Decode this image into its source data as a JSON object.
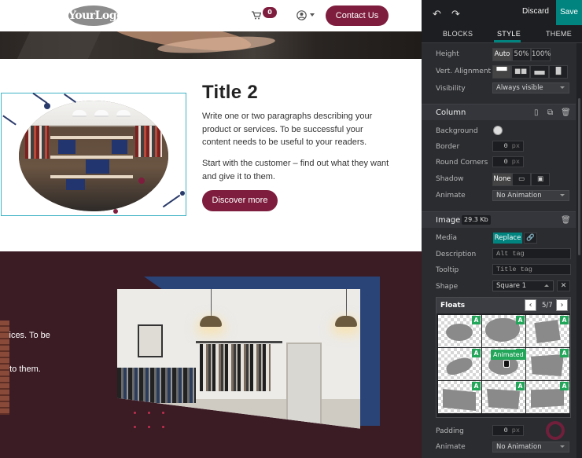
{
  "site": {
    "header": {
      "logo_text": "YourLogo",
      "cart_count": "0",
      "contact_label": "Contact Us"
    },
    "section1": {
      "title": "Title 2",
      "paragraph1": "Write one or two paragraphs describing your product or services. To be successful your content needs to be useful to your readers.",
      "paragraph2": "Start with the customer – find out what they want and give it to them.",
      "button_label": "Discover more"
    },
    "section2": {
      "partial_line1": "vices. To be",
      "partial_line2": "t to them."
    }
  },
  "panel": {
    "toolbar": {
      "discard": "Discard",
      "save": "Save"
    },
    "tabs": [
      {
        "label": "BLOCKS",
        "active": false
      },
      {
        "label": "STYLE",
        "active": true
      },
      {
        "label": "THEME",
        "active": false
      }
    ],
    "height": {
      "label": "Height",
      "options": [
        "Auto",
        "50%",
        "100%"
      ],
      "selected": "Auto"
    },
    "vert_alignment": {
      "label": "Vert. Alignment"
    },
    "visibility": {
      "label": "Visibility",
      "value": "Always visible"
    },
    "column": {
      "title": "Column",
      "background_label": "Background",
      "border_label": "Border",
      "border_value": "0",
      "border_unit": "px",
      "round_corners_label": "Round Corners",
      "round_corners_value": "0",
      "round_corners_unit": "px",
      "shadow_label": "Shadow",
      "shadow_none": "None",
      "animate_label": "Animate",
      "animate_value": "No Animation"
    },
    "image": {
      "title": "Image",
      "size": "29.3 Kb",
      "media_label": "Media",
      "replace_label": "Replace",
      "description_label": "Description",
      "description_placeholder": "Alt tag",
      "tooltip_label": "Tooltip",
      "tooltip_placeholder": "Title tag",
      "shape_label": "Shape",
      "shape_value": "Square 1",
      "padding_label": "Padding",
      "padding_value": "0",
      "padding_unit": "px",
      "animate_label": "Animate",
      "animate_value": "No Animation"
    },
    "shape_popover": {
      "title": "Floats",
      "page": "5/7",
      "prev": "‹",
      "next": "›",
      "badge": "A",
      "hover_tooltip": "Animated"
    }
  },
  "colors": {
    "brand": "#7e1d3d",
    "teal": "#01847f",
    "panel_bg": "#2a2c30",
    "section2_bg": "#3b1b24",
    "selection": "#41b3c4",
    "badge_green": "#23a55a"
  }
}
